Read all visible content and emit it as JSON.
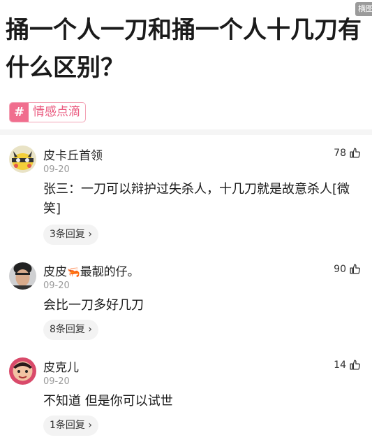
{
  "corner_badge": "横图",
  "title": "捅一个人一刀和捅一个人十几刀有什么区别？",
  "topic": {
    "icon": "hash-icon",
    "label": "情感点滴",
    "color": "#f06e8e"
  },
  "comments": [
    {
      "username": "皮卡丘首领",
      "date": "09-20",
      "content": "张三：一刀可以辩护过失杀人，十几刀就是故意杀人[微笑]",
      "replies": "3条回复",
      "likes": "78"
    },
    {
      "username": "皮皮",
      "emoji": "🦐",
      "username_suffix": "最靓的仔。",
      "date": "09-20",
      "content": "会比一刀多好几刀",
      "replies": "8条回复",
      "likes": "90"
    },
    {
      "username": "皮克儿",
      "date": "09-20",
      "content": "不知道 但是你可以试世",
      "replies": "1条回复",
      "likes": "14"
    }
  ]
}
